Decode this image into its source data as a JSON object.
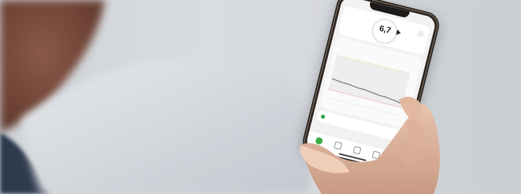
{
  "photo": {
    "subject": "hand-holding-smartphone",
    "background_colors": [
      "#d3d6db",
      "#7a4a3a",
      "#2e3a4e"
    ],
    "accent": "#3aaa49",
    "alert_low_color": "#e0524d",
    "alert_high_color": "#e8c547"
  },
  "app": {
    "glucose_value": "6,7",
    "trend_icon": "arrow-right-icon",
    "tabs": [
      "home-icon",
      "history-icon",
      "connections-icon",
      "menu-icon"
    ]
  }
}
